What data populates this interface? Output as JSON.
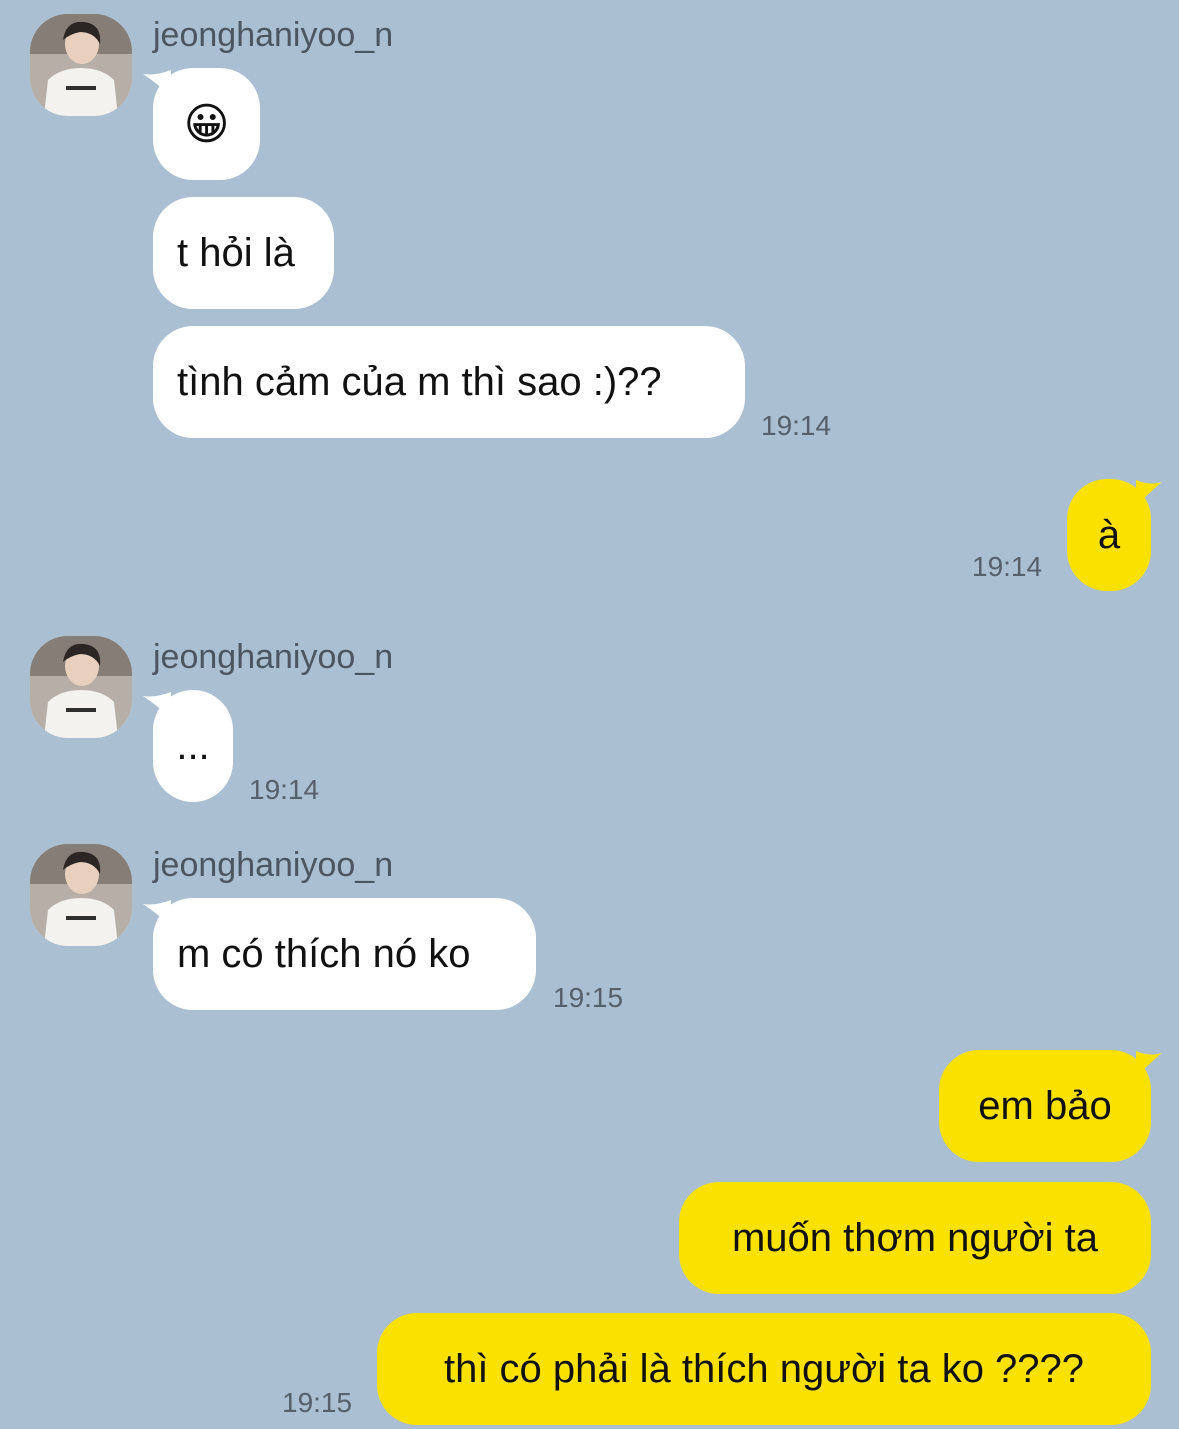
{
  "theme": {
    "background": "#aabfd2",
    "incoming_bubble": "#ffffff",
    "outgoing_bubble": "#fae100"
  },
  "messages": [
    {
      "sender": "jeonghaniyoo_n",
      "avatar": "profile-photo",
      "bubbles": [
        "😀",
        "t hỏi là",
        "tình cảm của m thì sao :)??"
      ],
      "time": "19:14"
    },
    {
      "outgoing": true,
      "bubbles": [
        "à"
      ],
      "time": "19:14"
    },
    {
      "sender": "jeonghaniyoo_n",
      "avatar": "profile-photo",
      "bubbles": [
        "..."
      ],
      "time": "19:14"
    },
    {
      "sender": "jeonghaniyoo_n",
      "avatar": "profile-photo",
      "bubbles": [
        "m có thích nó ko"
      ],
      "time": "19:15"
    },
    {
      "outgoing": true,
      "bubbles": [
        "em bảo",
        "muốn thơm người ta",
        "thì có phải là thích người ta ko ????"
      ],
      "time": "19:15"
    }
  ]
}
